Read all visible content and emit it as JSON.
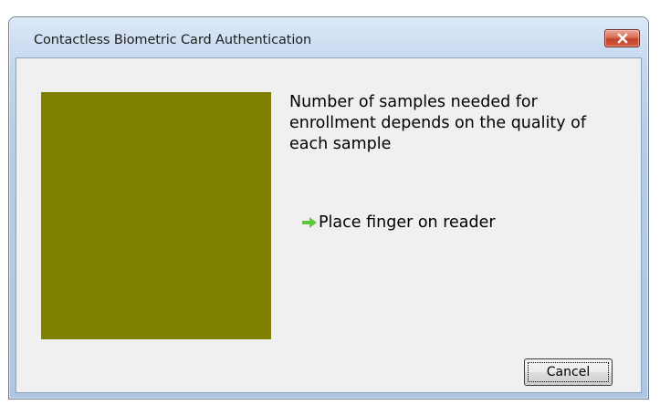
{
  "window": {
    "title": "Contactless Biometric Card Authentication",
    "close_icon": "close-x-icon"
  },
  "main": {
    "fingerprint_panel_color": "#808000",
    "message": "Number of samples needed for enrollment depends on the quality of each sample",
    "status_icon": "green-arrow-right-icon",
    "status_text": "Place finger on reader"
  },
  "buttons": {
    "cancel_label": "Cancel"
  },
  "colors": {
    "panel": "#808000",
    "arrow": "#5cc83a",
    "close_button": "#c3412b"
  }
}
